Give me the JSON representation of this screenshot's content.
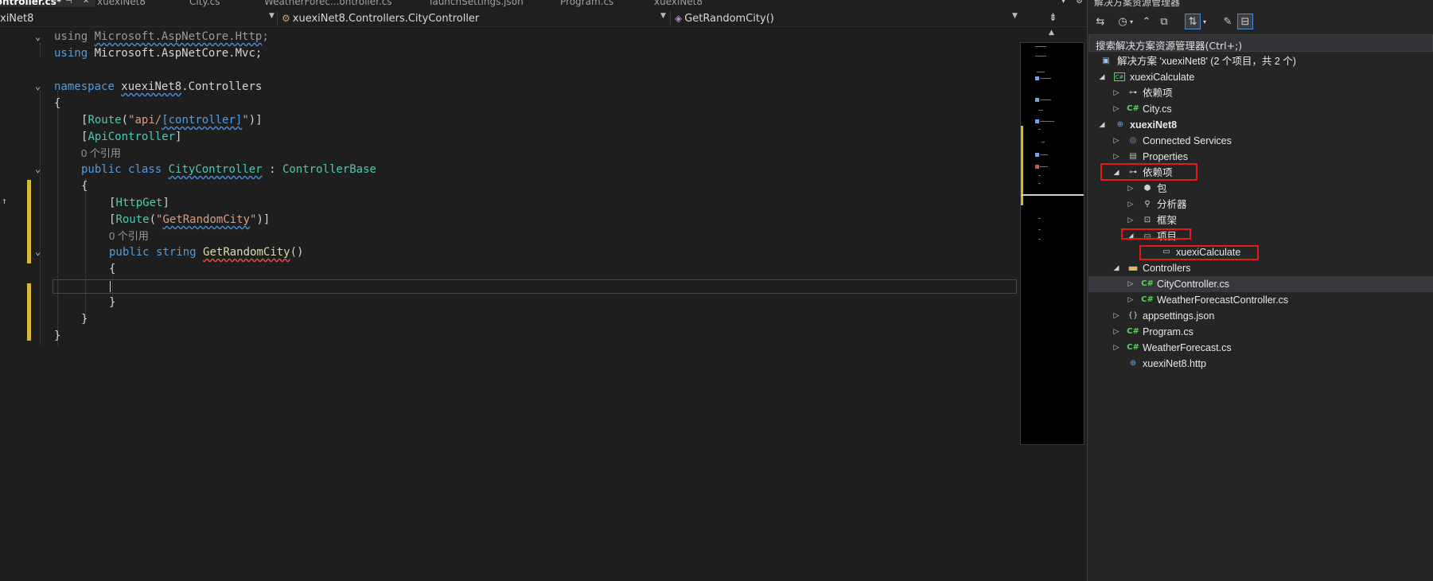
{
  "tabs": [
    {
      "label": "Controller.cs*",
      "active": true
    },
    {
      "label": "xuexiNet8",
      "active": false
    },
    {
      "label": "City.cs",
      "active": false
    },
    {
      "label": "WeatherForec...ontroller.cs",
      "active": false
    },
    {
      "label": "launchSettings.json",
      "active": false
    },
    {
      "label": "Program.cs",
      "active": false
    },
    {
      "label": "xuexiNet8",
      "active": false
    }
  ],
  "tab_pin_icon": "⊣",
  "tab_close_icon": "✕",
  "navigation": {
    "project": "xiNet8",
    "type": "xuexiNet8.Controllers.CityController",
    "member": "GetRandomCity()"
  },
  "code": {
    "l1_kw": "using",
    "l1_ns": "Microsoft.AspNetCore.Http",
    "l1_end": ";",
    "l2_kw": "using",
    "l2_ns": "Microsoft.AspNetCore.Mvc",
    "l2_end": ";",
    "l4_kw": "namespace",
    "l4_ns1": "xuexiNet8",
    "l4_dot": ".",
    "l4_ns2": "Controllers",
    "l5": "{",
    "l6_open": "[",
    "l6_attr": "Route",
    "l6_paren": "(",
    "l6_str1": "\"api/",
    "l6_str2": "[controller]",
    "l6_str3": "\"",
    "l6_close": ")]",
    "l7_open": "[",
    "l7_attr": "ApiController",
    "l7_close": "]",
    "lens1": "0 个引用",
    "l8_kw1": "public",
    "l8_kw2": "class",
    "l8_cls": "CityController",
    "l8_colon": ":",
    "l8_base": "ControllerBase",
    "l9": "{",
    "l10_open": "[",
    "l10_attr": "HttpGet",
    "l10_close": "]",
    "l11_open": "[",
    "l11_attr": "Route",
    "l11_paren": "(",
    "l11_str1": "\"",
    "l11_str2": "GetRandomCity",
    "l11_str3": "\"",
    "l11_close": ")]",
    "lens2": "0 个引用",
    "l12_kw1": "public",
    "l12_kw2": "string",
    "l12_method": "GetRandomCity",
    "l12_parens": "()",
    "l13": "{",
    "l15": "}",
    "l16": "}",
    "l17": "}"
  },
  "explorer": {
    "title": "解决方案资源管理器",
    "search_placeholder": "搜索解决方案资源管理器(Ctrl+;)",
    "tree": [
      {
        "label": "解决方案 'xuexiNet8' (2 个项目，共 2 个)",
        "icon": "solution-icon"
      },
      {
        "label": "xuexiCalculate",
        "icon": "csharp-project-icon"
      },
      {
        "label": "依赖项",
        "icon": "dependencies-icon"
      },
      {
        "label": "City.cs",
        "icon": "csharp-file-icon"
      },
      {
        "label": "xuexiNet8",
        "icon": "web-project-icon"
      },
      {
        "label": "Connected Services",
        "icon": "connected-services-icon"
      },
      {
        "label": "Properties",
        "icon": "properties-icon"
      },
      {
        "label": "依赖项",
        "icon": "dependencies-icon"
      },
      {
        "label": "包",
        "icon": "package-icon"
      },
      {
        "label": "分析器",
        "icon": "analyzer-icon"
      },
      {
        "label": "框架",
        "icon": "framework-icon"
      },
      {
        "label": "项目",
        "icon": "projects-icon"
      },
      {
        "label": "xuexiCalculate",
        "icon": "project-reference-icon"
      },
      {
        "label": "Controllers",
        "icon": "folder-icon"
      },
      {
        "label": "CityController.cs",
        "icon": "csharp-file-icon"
      },
      {
        "label": "WeatherForecastController.cs",
        "icon": "csharp-file-icon"
      },
      {
        "label": "appsettings.json",
        "icon": "json-file-icon"
      },
      {
        "label": "Program.cs",
        "icon": "csharp-file-icon"
      },
      {
        "label": "WeatherForecast.cs",
        "icon": "csharp-file-icon"
      },
      {
        "label": "xuexiNet8.http",
        "icon": "http-file-icon"
      }
    ]
  },
  "colors": {
    "editor_bg": "#1e1e1e",
    "keyword": "#569cd6",
    "type": "#4ec9b0",
    "string": "#d69d85",
    "method": "#dcdcaa",
    "highlight_box": "#e81818",
    "change_bar": "#d6b93b"
  }
}
